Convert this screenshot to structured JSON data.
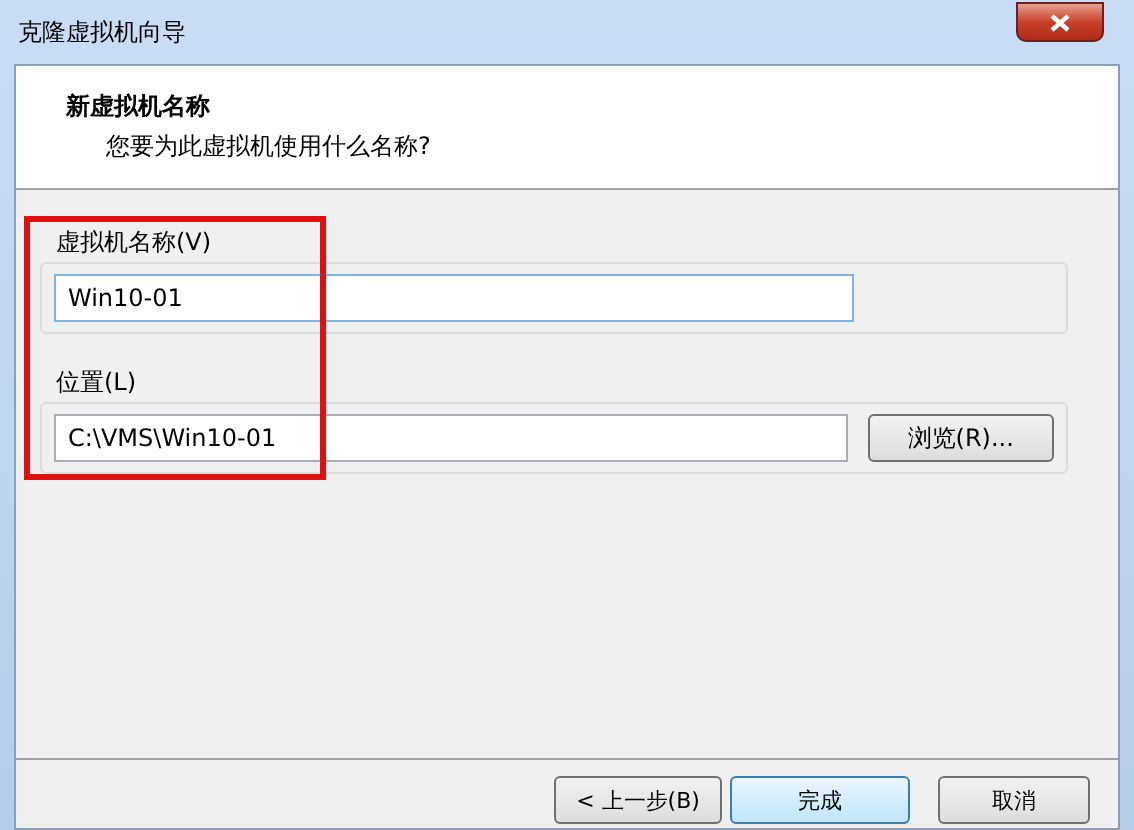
{
  "window": {
    "title": "克隆虚拟机向导"
  },
  "header": {
    "title": "新虚拟机名称",
    "subtitle": "您要为此虚拟机使用什么名称?"
  },
  "fields": [
    {
      "label": "虚拟机名称(V)",
      "value": "Win10-01",
      "focused": true
    },
    {
      "label": "位置(L)",
      "value": "C:\\VMS\\Win10-01",
      "focused": false,
      "button": "浏览(R)..."
    }
  ],
  "buttons": [
    {
      "label": "< 上一步(B)",
      "default": false
    },
    {
      "label": "完成",
      "default": true
    },
    {
      "label": "取消",
      "default": false
    }
  ]
}
